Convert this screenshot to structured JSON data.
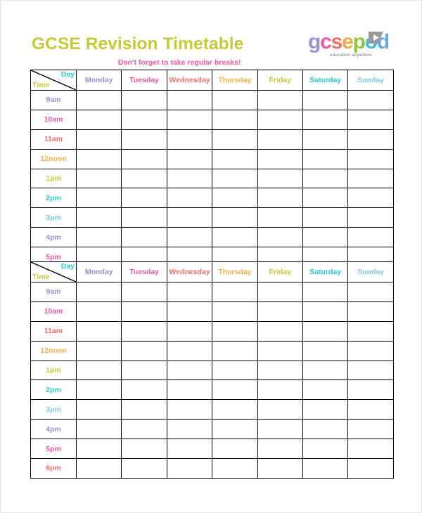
{
  "document": {
    "title": "GCSE Revision Timetable",
    "subtitle": "Don't forget to take regular breaks!",
    "title_color": "#c3c93a",
    "subtitle_color": "#ee5aa4"
  },
  "logo": {
    "wordmark": "gcsepod",
    "tagline": "education anywhere",
    "letters": [
      {
        "char": "g",
        "color": "#9b8fd4"
      },
      {
        "char": "c",
        "color": "#ee5aa4"
      },
      {
        "char": "s",
        "color": "#f2706a"
      },
      {
        "char": "e",
        "color": "#f5a84b"
      },
      {
        "char": "p",
        "color": "#8ec63f"
      },
      {
        "char": "o",
        "color": "#3fc0d8"
      },
      {
        "char": "d",
        "color": "#6aa9e0"
      }
    ],
    "play_icon_color": "#9a9a9a",
    "tagline_color": "#7c7c7c"
  },
  "palette": {
    "purple": "#9b8fd4",
    "pink": "#ee5aa4",
    "red": "#f2706a",
    "orange": "#f5b14b",
    "olive": "#c3c93a",
    "teal": "#2ec8d0",
    "blue": "#7dc8ec"
  },
  "corner": {
    "day_label": "Day",
    "time_label": "Time",
    "day_color": "#2ec8d0",
    "time_color": "#c3c93a"
  },
  "days": [
    {
      "label": "Monday",
      "color": "#9b8fd4"
    },
    {
      "label": "Tuesday",
      "color": "#ee5aa4"
    },
    {
      "label": "Wednesday",
      "color": "#f2706a"
    },
    {
      "label": "Thursday",
      "color": "#f5b14b"
    },
    {
      "label": "Friday",
      "color": "#c3c93a"
    },
    {
      "label": "Saturday",
      "color": "#2ec8d0"
    },
    {
      "label": "Sunday",
      "color": "#7dc8ec"
    }
  ],
  "table_1": {
    "times": [
      {
        "label": "9am",
        "color": "#9b8fd4"
      },
      {
        "label": "10am",
        "color": "#ee5aa4"
      },
      {
        "label": "11am",
        "color": "#f2706a"
      },
      {
        "label": "12noon",
        "color": "#f5b14b"
      },
      {
        "label": "1pm",
        "color": "#c3c93a"
      },
      {
        "label": "2pm",
        "color": "#2ec8d0"
      },
      {
        "label": "3pm",
        "color": "#7dc8ec"
      },
      {
        "label": "4pm",
        "color": "#9b8fd4"
      },
      {
        "label": "5pm",
        "color": "#ee5aa4"
      }
    ]
  },
  "table_2": {
    "times": [
      {
        "label": "9am",
        "color": "#9b8fd4"
      },
      {
        "label": "10am",
        "color": "#ee5aa4"
      },
      {
        "label": "11am",
        "color": "#f2706a"
      },
      {
        "label": "12noon",
        "color": "#f5b14b"
      },
      {
        "label": "1pm",
        "color": "#c3c93a"
      },
      {
        "label": "2pm",
        "color": "#2ec8d0"
      },
      {
        "label": "3pm",
        "color": "#7dc8ec"
      },
      {
        "label": "4pm",
        "color": "#9b8fd4"
      },
      {
        "label": "5pm",
        "color": "#ee5aa4"
      },
      {
        "label": "6pm",
        "color": "#f2706a"
      }
    ]
  }
}
